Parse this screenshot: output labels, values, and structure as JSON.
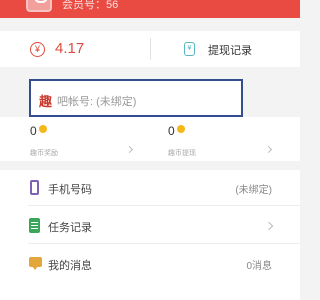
{
  "header": {
    "member_id": "会员号：56"
  },
  "balance": {
    "currency_icon": "yen-icon",
    "amount": "4.17",
    "withdraw_icon": "withdraw-record-icon",
    "withdraw_label": "提现记录"
  },
  "qu_account": {
    "qu_char": "趣",
    "rest_text": "吧帐号: (未绑定)"
  },
  "stats": [
    {
      "value": "0",
      "label": "趣币奖励"
    },
    {
      "value": "0",
      "label": "趣币提现"
    }
  ],
  "list": {
    "phone": {
      "label": "手机号码",
      "value": "(未绑定)"
    },
    "tasks": {
      "label": "任务记录"
    },
    "messages": {
      "label": "我的消息",
      "value": "0消息"
    }
  },
  "colors": {
    "header": "#e94a42",
    "accent_red": "#e04a3f",
    "highlight_border": "#334d8f",
    "coin": "#f5b81c"
  }
}
